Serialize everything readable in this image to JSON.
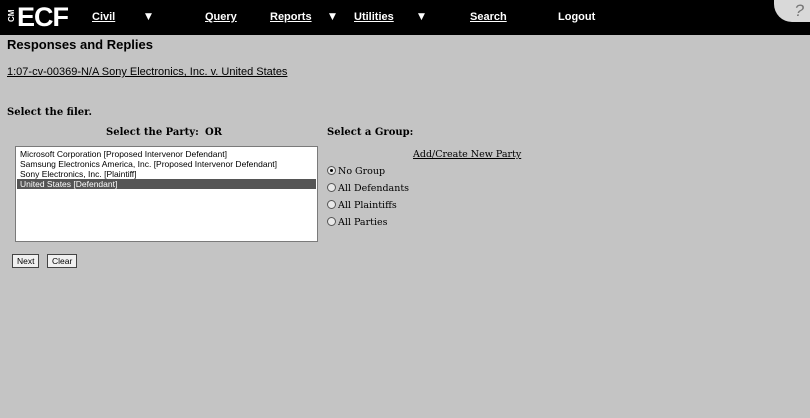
{
  "nav": {
    "logo": "ECF",
    "logo_prefix": "CM",
    "items": [
      {
        "label": "Civil",
        "has_caret": true
      },
      {
        "label": "Query",
        "has_caret": false
      },
      {
        "label": "Reports",
        "has_caret": true
      },
      {
        "label": "Utilities",
        "has_caret": true
      },
      {
        "label": "Search",
        "has_caret": false
      },
      {
        "label": "Logout",
        "has_caret": false
      }
    ],
    "help": "?"
  },
  "page": {
    "title": "Responses and Replies",
    "case_link": "1:07-cv-00369-N/A Sony Electronics, Inc. v. United States",
    "select_filer": "Select the filer.",
    "select_party": "Select the Party:",
    "or": "OR",
    "select_group": "Select a Group:",
    "add_party": "Add/Create New Party"
  },
  "parties": [
    {
      "label": "Microsoft Corporation [Proposed Intervenor Defendant]",
      "selected": false
    },
    {
      "label": "Samsung Electronics America, Inc. [Proposed Intervenor Defendant]",
      "selected": false
    },
    {
      "label": "Sony Electronics, Inc. [Plaintiff]",
      "selected": false
    },
    {
      "label": "United States [Defendant]",
      "selected": true
    }
  ],
  "groups": [
    {
      "label": "No Group",
      "checked": true
    },
    {
      "label": "All Defendants",
      "checked": false
    },
    {
      "label": "All Plaintiffs",
      "checked": false
    },
    {
      "label": "All Parties",
      "checked": false
    }
  ],
  "buttons": {
    "next": "Next",
    "clear": "Clear"
  }
}
